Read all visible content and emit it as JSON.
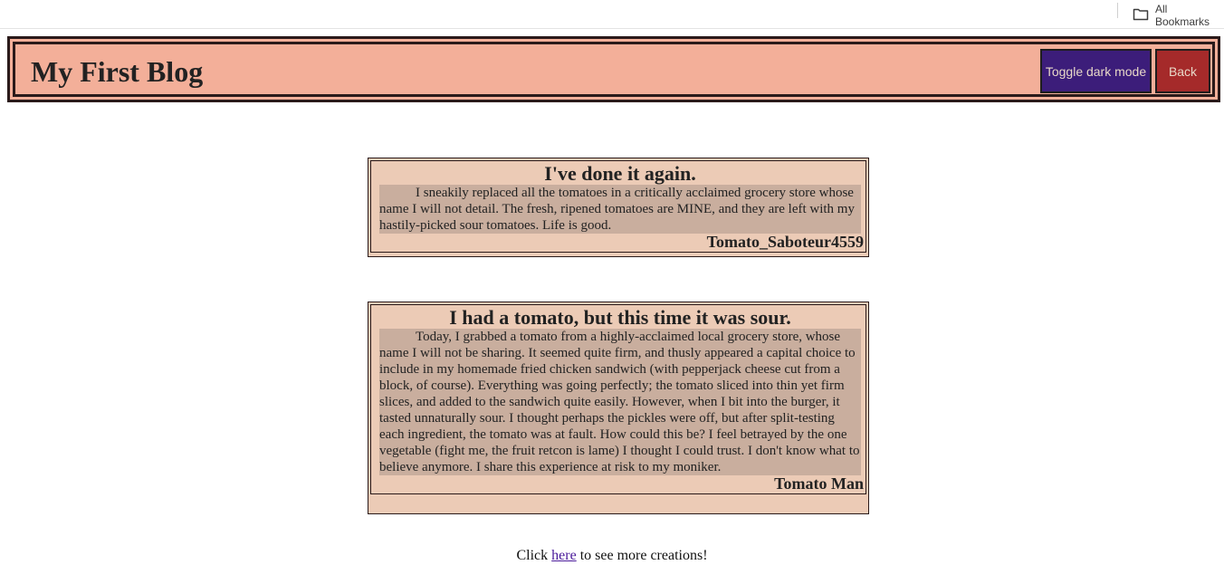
{
  "browser": {
    "bookmarks_label": "All Bookmarks"
  },
  "header": {
    "title": "My First Blog",
    "toggle_label": "Toggle dark mode",
    "back_label": "Back"
  },
  "posts": [
    {
      "title": "I've done it again.",
      "body": "I sneakily replaced all the tomatoes in a critically acclaimed grocery store whose name I will not detail. The fresh, ripened tomatoes are MINE, and they are left with my hastily-picked sour tomatoes. Life is good.",
      "author": "Tomato_Saboteur4559"
    },
    {
      "title": "I had a tomato, but this time it was sour.",
      "body": "Today, I grabbed a tomato from a highly-acclaimed local grocery store, whose name I will not be sharing. It seemed quite firm, and thusly appeared a capital choice to include in my homemade fried chicken sandwich (with pepperjack cheese cut from a block, of course). Everything was going perfectly; the tomato sliced into thin yet firm slices, and added to the sandwich quite easily. However, when I bit into the burger, it tasted unnaturally sour. I thought perhaps the pickles were off, but after split-testing each ingredient, the tomato was at fault. How could this be? I feel betrayed by the one vegetable (fight me, the fruit retcon is lame) I thought I could trust. I don't know what to believe anymore. I share this experience at risk to my moniker.",
      "author": "Tomato Man"
    }
  ],
  "footer": {
    "prefix": "Click ",
    "link": "here",
    "suffix": " to see more creations!"
  },
  "colors": {
    "header_bg": "#f3af99",
    "toggle_bg": "#3c1d7a",
    "back_bg": "#a52a2a",
    "post_bg": "#eccbb6",
    "post_body_bg": "#c9ae9e"
  }
}
